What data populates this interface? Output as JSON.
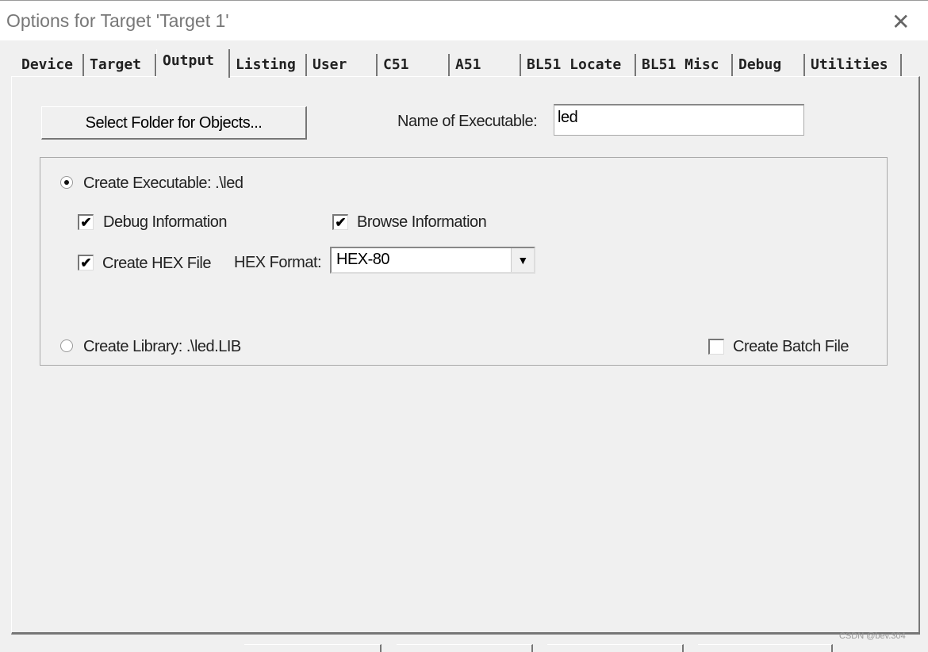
{
  "window": {
    "title": "Options for Target 'Target 1'"
  },
  "tabs": [
    {
      "label": "Device"
    },
    {
      "label": "Target"
    },
    {
      "label": "Output",
      "selected": true
    },
    {
      "label": "Listing"
    },
    {
      "label": "User"
    },
    {
      "label": "C51"
    },
    {
      "label": "A51"
    },
    {
      "label": "BL51 Locate"
    },
    {
      "label": "BL51 Misc"
    },
    {
      "label": "Debug"
    },
    {
      "label": "Utilities"
    }
  ],
  "output": {
    "select_folder_label": "Select Folder for Objects...",
    "name_label": "Name of Executable:",
    "name_value": "led",
    "create_executable_label": "Create Executable:  .\\led",
    "create_executable_selected": true,
    "debug_info_label": "Debug Information",
    "debug_info_checked": true,
    "browse_info_label": "Browse Information",
    "browse_info_checked": true,
    "create_hex_label": "Create HEX File",
    "create_hex_checked": true,
    "hex_format_label": "HEX Format:",
    "hex_format_value": "HEX-80",
    "create_library_label": "Create Library:  .\\led.LIB",
    "create_library_selected": false,
    "batch_label": "Create Batch File",
    "batch_checked": false
  },
  "watermark": "CSDN @bev.304"
}
